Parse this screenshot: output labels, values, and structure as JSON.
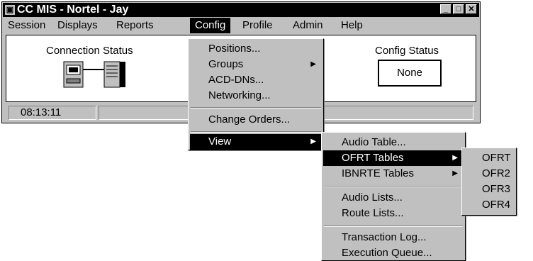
{
  "window": {
    "title": "CC MIS - Nortel - Jay",
    "app_icon": "app-icon",
    "controls": {
      "minimize": "_",
      "maximize": "□",
      "close": "✕"
    }
  },
  "menubar": {
    "items": [
      {
        "label": "Session"
      },
      {
        "label": "Displays"
      },
      {
        "label": "Reports"
      },
      {
        "label": "Config"
      },
      {
        "label": "Profile"
      },
      {
        "label": "Admin"
      },
      {
        "label": "Help"
      }
    ],
    "active": "Config"
  },
  "panel": {
    "connection_status_label": "Connection Status",
    "connection_icon": "network-connection-icon",
    "config_status_label": "Config Status",
    "config_status_value": "None"
  },
  "statusbar": {
    "time": "08:13:11"
  },
  "config_menu": {
    "items": [
      {
        "label": "Positions..."
      },
      {
        "label": "Groups",
        "submenu": true
      },
      {
        "label": "ACD-DNs..."
      },
      {
        "label": "Networking..."
      },
      {
        "label": "Change Orders..."
      },
      {
        "label": "View",
        "submenu": true,
        "active": true
      }
    ]
  },
  "view_menu": {
    "items": [
      {
        "label": "Audio Table..."
      },
      {
        "label": "OFRT Tables",
        "submenu": true,
        "active": true
      },
      {
        "label": "IBNRTE Tables",
        "submenu": true
      },
      {
        "label": "Audio Lists..."
      },
      {
        "label": "Route Lists..."
      },
      {
        "label": "Transaction Log..."
      },
      {
        "label": "Execution Queue..."
      }
    ]
  },
  "ofrt_menu": {
    "items": [
      {
        "label": "OFRT"
      },
      {
        "label": "OFR2"
      },
      {
        "label": "OFR3"
      },
      {
        "label": "OFR4"
      }
    ]
  },
  "colors": {
    "face": "#c0c0c0",
    "highlight": "#000000",
    "highlight_text": "#ffffff"
  }
}
